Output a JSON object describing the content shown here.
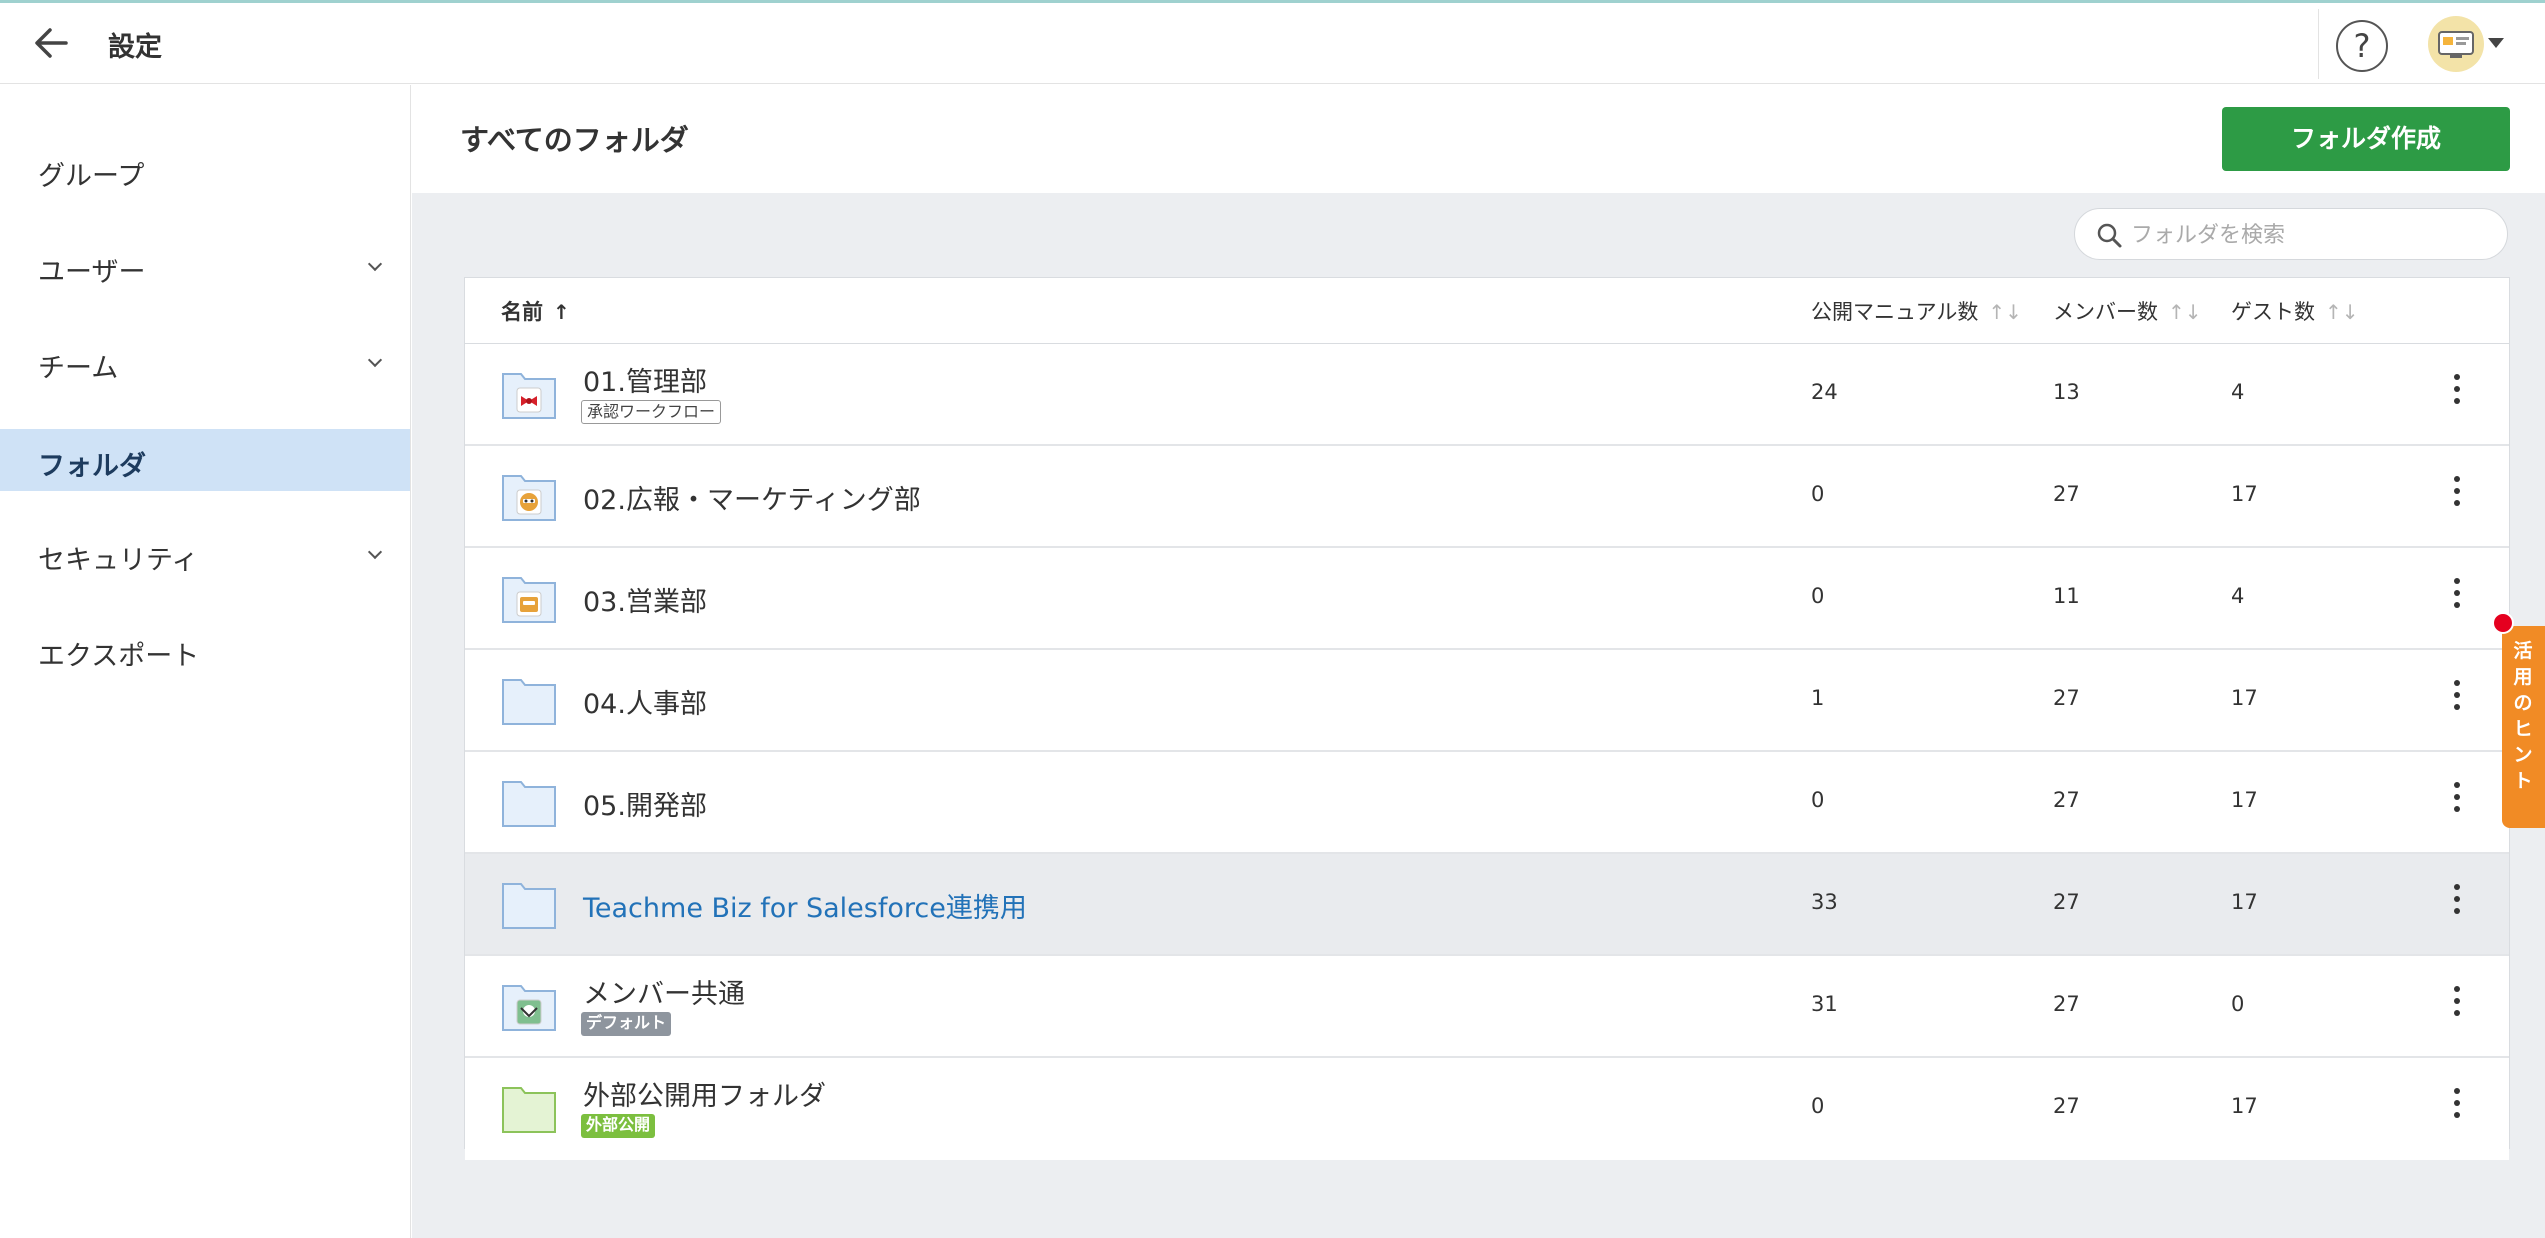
{
  "header": {
    "title": "設定",
    "help_glyph": "?"
  },
  "sidebar": {
    "items": [
      {
        "label": "グループ",
        "has_chevron": false
      },
      {
        "label": "ユーザー",
        "has_chevron": true
      },
      {
        "label": "チーム",
        "has_chevron": true
      },
      {
        "label": "フォルダ",
        "has_chevron": false,
        "active": true
      },
      {
        "label": "セキュリティ",
        "has_chevron": true
      },
      {
        "label": "エクスポート",
        "has_chevron": false
      }
    ]
  },
  "main": {
    "title": "すべてのフォルダ",
    "create_button": "フォルダ作成",
    "search": {
      "placeholder": "フォルダを検索",
      "value": ""
    }
  },
  "table": {
    "columns": {
      "name": "名前",
      "manuals": "公開マニュアル数",
      "members": "メンバー数",
      "guests": "ゲスト数"
    },
    "rows": [
      {
        "name": "01.管理部",
        "badge": "承認ワークフロー",
        "manuals": "24",
        "members": "13",
        "guests": "4"
      },
      {
        "name": "02.広報・マーケティング部",
        "badge": "",
        "manuals": "0",
        "members": "27",
        "guests": "17"
      },
      {
        "name": "03.営業部",
        "badge": "",
        "manuals": "0",
        "members": "11",
        "guests": "4"
      },
      {
        "name": "04.人事部",
        "badge": "",
        "manuals": "1",
        "members": "27",
        "guests": "17"
      },
      {
        "name": "05.開発部",
        "badge": "",
        "manuals": "0",
        "members": "27",
        "guests": "17"
      },
      {
        "name": "Teachme Biz for Salesforce連携用",
        "badge": "",
        "manuals": "33",
        "members": "27",
        "guests": "17"
      },
      {
        "name": "メンバー共通",
        "badge": "デフォルト",
        "manuals": "31",
        "members": "27",
        "guests": "0"
      },
      {
        "name": "外部公開用フォルダ",
        "badge": "外部公開",
        "manuals": "0",
        "members": "27",
        "guests": "17"
      }
    ]
  },
  "hint_tab": {
    "label": "活用のヒント"
  },
  "colors": {
    "accent_green": "#2d9b45",
    "active_nav_bg": "#cfe2f6",
    "link_blue": "#2272b8",
    "hint_orange": "#f18b25",
    "notification_red": "#e5001f"
  }
}
